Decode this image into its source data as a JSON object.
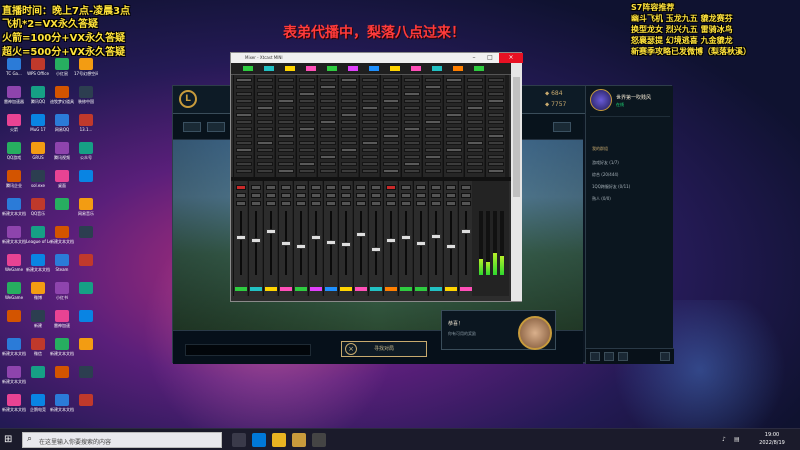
{
  "overlay_left": [
    "直播时间：晚上7点-凌晨3点",
    "飞机*2=VX永久答疑",
    "火箭=100分+VX永久答疑",
    "超火=500分+VX永久答疑"
  ],
  "overlay_right": [
    "S7阵容推荐",
    "幽斗飞机 玉龙九五 貔龙赛芬",
    "换型龙女 烈兴九五 雷骑冰鸟",
    "怒襄瑟提 幻境逃喜 九金貔龙",
    "新赛季攻略已发微博（梨落秋溪）"
  ],
  "banner": "表弟代播中，梨落八点过来！",
  "desktop_icons": [
    "TC Ga...",
    "WPS Office",
    "小红鼠",
    "17号幻想空间",
    "雷神加速器",
    "腾讯QQ",
    "迪牧梦幻道具",
    "装修中国",
    "火箭",
    "MuG 17",
    "网易QQ",
    "13.1...",
    "QQ游戏",
    "GRUS",
    "腾讯视频",
    "公众号",
    "腾讯企业",
    "sol.exe",
    "桌面",
    "",
    "新建文本文档",
    "QQ音乐",
    "",
    "网易音乐",
    "新建文本文档",
    "League of Legends",
    "新建文本文档",
    "",
    "WeGame",
    "新建文本文档",
    "Steam",
    "",
    "WeGame",
    "微博",
    "小红书",
    "",
    "",
    "新建",
    "雷神加速",
    "",
    "新建文本文档",
    "微信",
    "新建文本文档",
    "",
    "新建文本文档",
    "",
    "",
    "",
    "新建文本文档",
    "企鹅电竞",
    "新建文本文档",
    ""
  ],
  "client": {
    "currency_be": "684",
    "currency_rp": "7757",
    "find_match": "寻找对局",
    "notice_header": "",
    "notice_title": "恭喜！",
    "notice_desc": "你有可用的奖励",
    "social": {
      "summoner_name": "世界第一吹贱风",
      "status": "在线",
      "section_title": "我的群组",
      "groups": [
        "游戏好友 (1/7)",
        "综合 (20/444)",
        "1QQ跨服好友 (0/11)",
        "熟人 (0/0)"
      ]
    }
  },
  "mixer": {
    "window_title": "Mixer - Xtcast MINI",
    "ch_colors": [
      "#2ecc40",
      "#22c1c3",
      "#ffd400",
      "#ff4fb8",
      "#2ecc40",
      "#e040fb",
      "#1e90ff",
      "#ffd400",
      "#ff4fb8",
      "#22c1c3",
      "#ff7f00",
      "#2ecc40"
    ],
    "fader_levels": [
      0.6,
      0.55,
      0.7,
      0.5,
      0.45,
      0.6,
      0.52,
      0.48,
      0.65,
      0.4,
      0.55,
      0.6,
      0.5,
      0.62,
      0.45,
      0.7
    ],
    "meter_levels": [
      0.25,
      0.2,
      0.35,
      0.3
    ]
  },
  "taskbar": {
    "search_placeholder": "在这里输入你要搜索的内容",
    "clock_time": "19:00",
    "clock_date": "2022/8/19"
  }
}
